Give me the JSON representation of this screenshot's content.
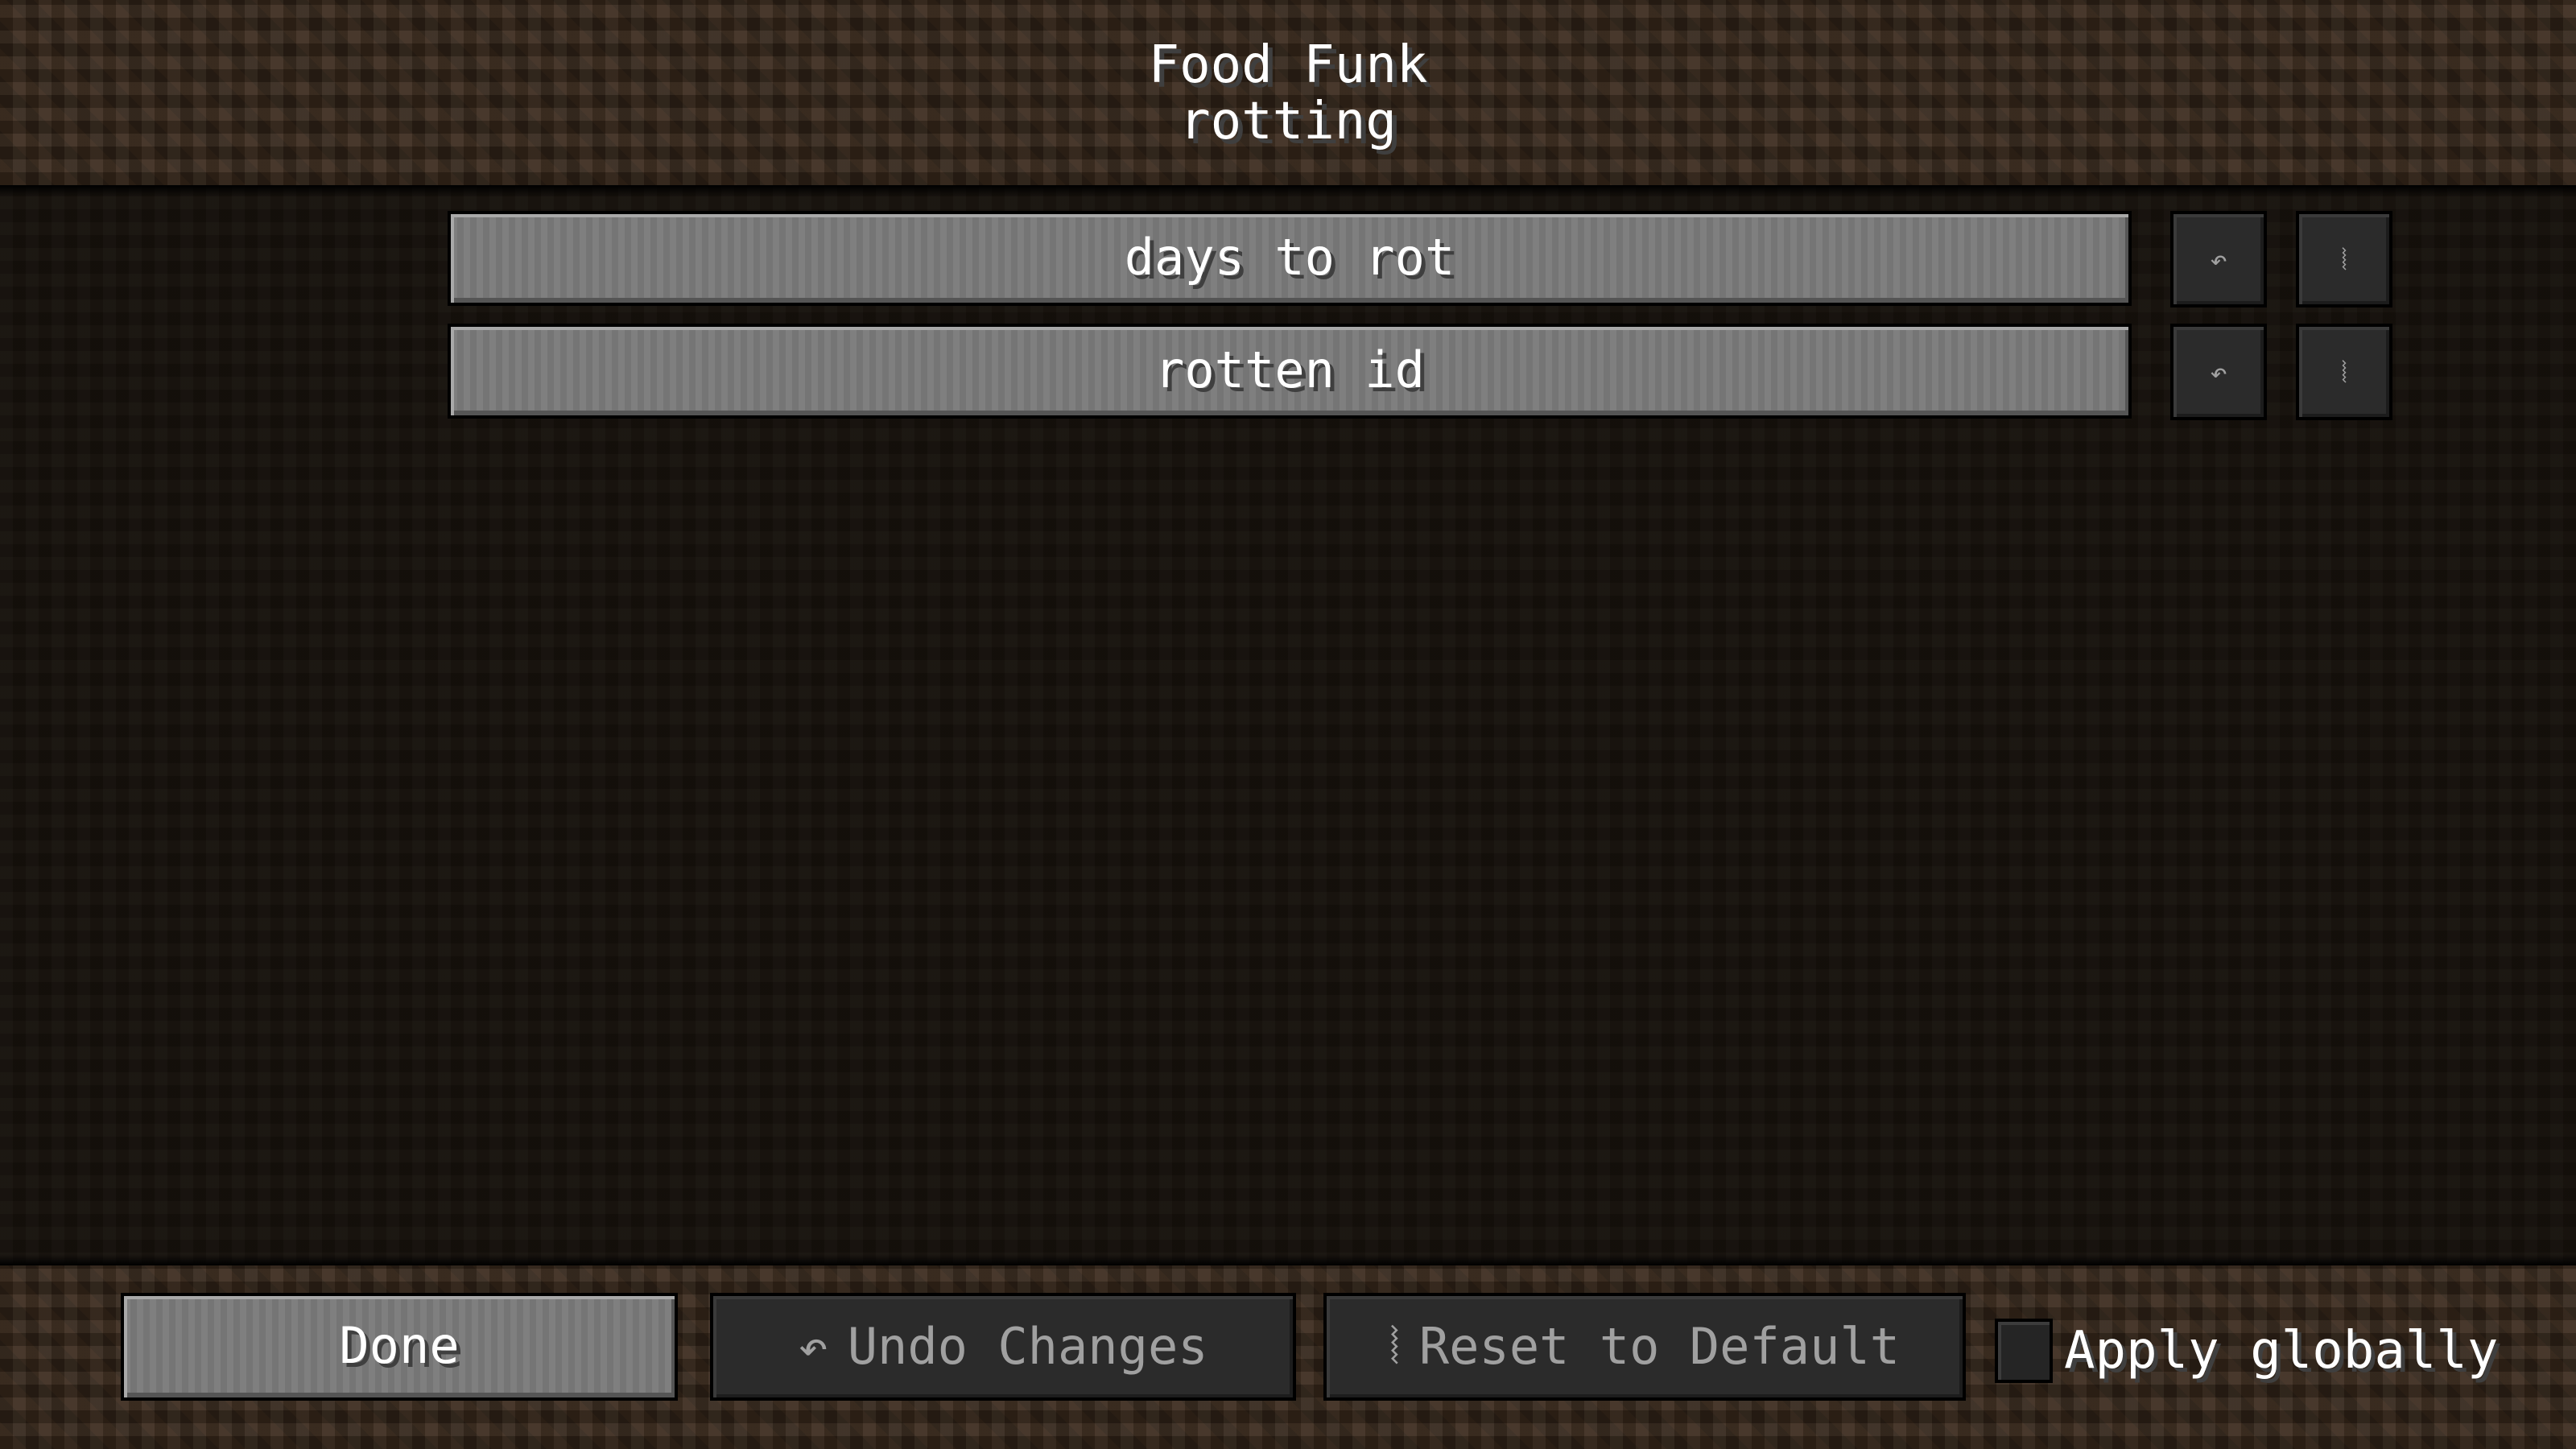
{
  "header": {
    "title_line1": "Food Funk",
    "title_line2": "rotting"
  },
  "entries": [
    {
      "label": "days to rot",
      "undo_icon": "undo-arrow-icon",
      "reset_icon": "reset-icon"
    },
    {
      "label": "rotten id",
      "undo_icon": "undo-arrow-icon",
      "reset_icon": "reset-icon"
    }
  ],
  "icons": {
    "undo_glyph": "↶",
    "reset_glyph": "⦚"
  },
  "footer": {
    "done_label": "Done",
    "undo_label": "Undo Changes",
    "reset_label": "Reset to Default",
    "apply_globally_label": "Apply globally",
    "apply_globally_checked": false
  }
}
